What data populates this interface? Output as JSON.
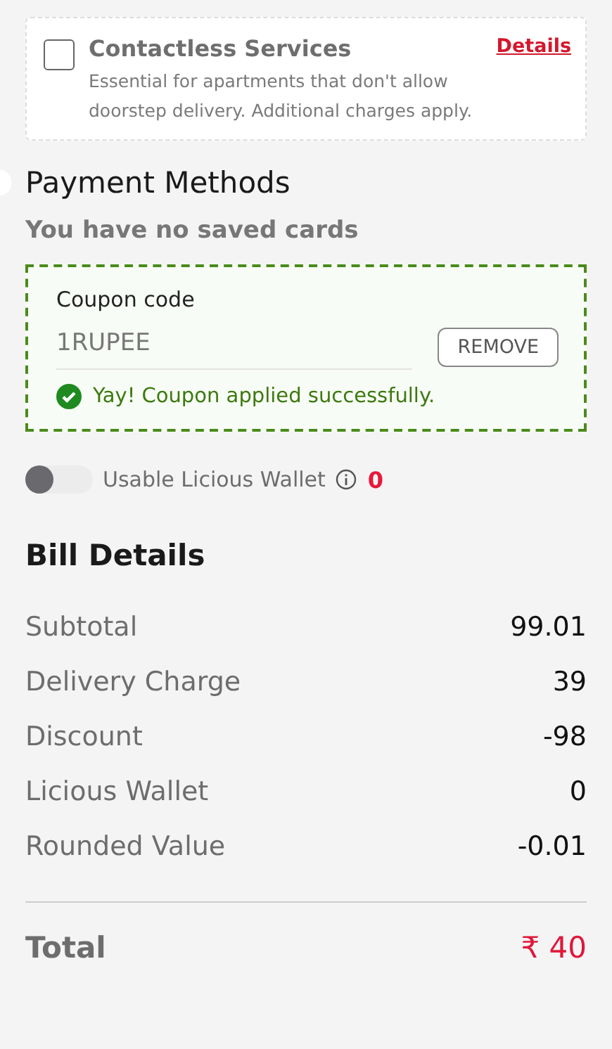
{
  "contactless": {
    "title": "Contactless Services",
    "description": "Essential for apartments that don't allow doorstep delivery. Additional charges apply.",
    "checked": false,
    "link": "Details"
  },
  "payment": {
    "radio_selected": false,
    "heading": "Payment Methods",
    "saved_cards": "You have no saved cards"
  },
  "coupon": {
    "label": "Coupon code",
    "value": "1RUPEE",
    "button": "REMOVE",
    "applied": true,
    "message": "Yay! Coupon applied successfully."
  },
  "wallet": {
    "label": "Usable Licious Wallet",
    "on": false,
    "amount": "0"
  },
  "bill": {
    "heading": "Bill Details",
    "rows": [
      {
        "label": "Subtotal",
        "value": "99.01"
      },
      {
        "label": "Delivery Charge",
        "value": "39"
      },
      {
        "label": "Discount",
        "value": "-98"
      },
      {
        "label": "Licious Wallet",
        "value": "0"
      },
      {
        "label": "Rounded Value",
        "value": "-0.01"
      }
    ],
    "total_label": "Total",
    "total_value": "₹ 40"
  }
}
